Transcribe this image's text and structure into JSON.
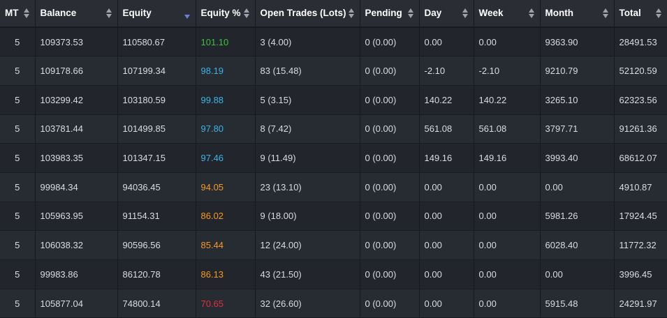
{
  "colors": {
    "green": "#3fbf3f",
    "blue": "#3cb4e6",
    "orange": "#f59a23",
    "red": "#e0313a",
    "sort_active": "#6f7fd6"
  },
  "columns": [
    {
      "key": "mt",
      "label": "MT",
      "sort": "both"
    },
    {
      "key": "balance",
      "label": "Balance",
      "sort": "both"
    },
    {
      "key": "equity",
      "label": "Equity",
      "sort": "desc-active"
    },
    {
      "key": "equity_pct",
      "label": "Equity %",
      "sort": "both"
    },
    {
      "key": "open_trades",
      "label": "Open Trades (Lots)",
      "sort": "both"
    },
    {
      "key": "pending",
      "label": "Pending",
      "sort": "both"
    },
    {
      "key": "day",
      "label": "Day",
      "sort": "both"
    },
    {
      "key": "week",
      "label": "Week",
      "sort": "both"
    },
    {
      "key": "month",
      "label": "Month",
      "sort": "both"
    },
    {
      "key": "total",
      "label": "Total",
      "sort": "both"
    }
  ],
  "rows": [
    {
      "mt": "5",
      "balance": "109373.53",
      "equity": "110580.67",
      "equity_pct": "101.10",
      "equity_pct_color": "green",
      "open_trades": "3 (4.00)",
      "pending": "0 (0.00)",
      "day": "0.00",
      "week": "0.00",
      "month": "9363.90",
      "total": "28491.53"
    },
    {
      "mt": "5",
      "balance": "109178.66",
      "equity": "107199.34",
      "equity_pct": "98.19",
      "equity_pct_color": "blue",
      "open_trades": "83 (15.48)",
      "pending": "0 (0.00)",
      "day": "-2.10",
      "week": "-2.10",
      "month": "9210.79",
      "total": "52120.59"
    },
    {
      "mt": "5",
      "balance": "103299.42",
      "equity": "103180.59",
      "equity_pct": "99.88",
      "equity_pct_color": "blue",
      "open_trades": "5 (3.15)",
      "pending": "0 (0.00)",
      "day": "140.22",
      "week": "140.22",
      "month": "3265.10",
      "total": "62323.56"
    },
    {
      "mt": "5",
      "balance": "103781.44",
      "equity": "101499.85",
      "equity_pct": "97.80",
      "equity_pct_color": "blue",
      "open_trades": "8 (7.42)",
      "pending": "0 (0.00)",
      "day": "561.08",
      "week": "561.08",
      "month": "3797.71",
      "total": "91261.36"
    },
    {
      "mt": "5",
      "balance": "103983.35",
      "equity": "101347.15",
      "equity_pct": "97.46",
      "equity_pct_color": "blue",
      "open_trades": "9 (11.49)",
      "pending": "0 (0.00)",
      "day": "149.16",
      "week": "149.16",
      "month": "3993.40",
      "total": "68612.07"
    },
    {
      "mt": "5",
      "balance": "99984.34",
      "equity": "94036.45",
      "equity_pct": "94.05",
      "equity_pct_color": "orange",
      "open_trades": "23 (13.10)",
      "pending": "0 (0.00)",
      "day": "0.00",
      "week": "0.00",
      "month": "0.00",
      "total": "4910.87"
    },
    {
      "mt": "5",
      "balance": "105963.95",
      "equity": "91154.31",
      "equity_pct": "86.02",
      "equity_pct_color": "orange",
      "open_trades": "9 (18.00)",
      "pending": "0 (0.00)",
      "day": "0.00",
      "week": "0.00",
      "month": "5981.26",
      "total": "17924.45"
    },
    {
      "mt": "5",
      "balance": "106038.32",
      "equity": "90596.56",
      "equity_pct": "85.44",
      "equity_pct_color": "orange",
      "open_trades": "12 (24.00)",
      "pending": "0 (0.00)",
      "day": "0.00",
      "week": "0.00",
      "month": "6028.40",
      "total": "11772.32"
    },
    {
      "mt": "5",
      "balance": "99983.86",
      "equity": "86120.78",
      "equity_pct": "86.13",
      "equity_pct_color": "orange",
      "open_trades": "43 (21.50)",
      "pending": "0 (0.00)",
      "day": "0.00",
      "week": "0.00",
      "month": "0.00",
      "total": "3996.45"
    },
    {
      "mt": "5",
      "balance": "105877.04",
      "equity": "74800.14",
      "equity_pct": "70.65",
      "equity_pct_color": "red",
      "open_trades": "32 (26.60)",
      "pending": "0 (0.00)",
      "day": "0.00",
      "week": "0.00",
      "month": "5915.48",
      "total": "24291.97"
    }
  ]
}
